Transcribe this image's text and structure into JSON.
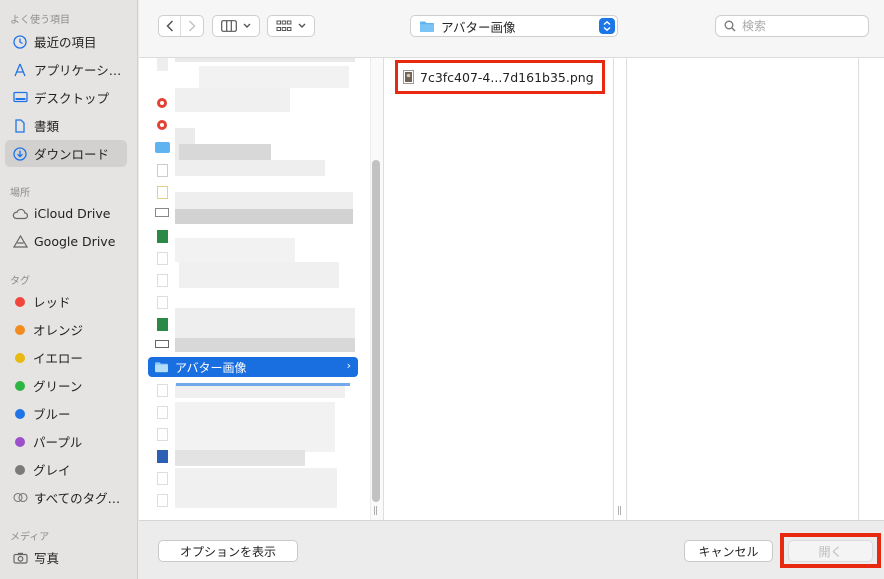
{
  "sidebar": {
    "favorites_heading": "よく使う項目",
    "favorites": [
      {
        "label": "最近の項目",
        "icon": "clock-icon"
      },
      {
        "label": "アプリケーシ…",
        "icon": "applications-icon"
      },
      {
        "label": "デスクトップ",
        "icon": "desktop-icon"
      },
      {
        "label": "書類",
        "icon": "document-icon"
      },
      {
        "label": "ダウンロード",
        "icon": "download-icon",
        "selected": true
      }
    ],
    "locations_heading": "場所",
    "locations": [
      {
        "label": "iCloud Drive",
        "icon": "cloud-icon"
      },
      {
        "label": "Google Drive",
        "icon": "drive-icon"
      }
    ],
    "tags_heading": "タグ",
    "tags": [
      {
        "label": "レッド",
        "color": "#f2453d"
      },
      {
        "label": "オレンジ",
        "color": "#f28c1e"
      },
      {
        "label": "イエロー",
        "color": "#e8b90f"
      },
      {
        "label": "グリーン",
        "color": "#2fb544"
      },
      {
        "label": "ブルー",
        "color": "#1f74e8"
      },
      {
        "label": "パープル",
        "color": "#9b4fc9"
      },
      {
        "label": "グレイ",
        "color": "#7a7a7a"
      },
      {
        "label": "すべてのタグ…",
        "color": ""
      }
    ],
    "media_heading": "メディア",
    "media": [
      {
        "label": "写真",
        "icon": "camera-icon"
      }
    ]
  },
  "toolbar": {
    "location": "アバター画像",
    "search_placeholder": "検索"
  },
  "browser": {
    "selected_folder": "アバター画像",
    "file_name": "7c3fc407-4...7d161b35.png"
  },
  "footer": {
    "options_label": "オプションを表示",
    "cancel_label": "キャンセル",
    "open_label": "開く"
  },
  "colors": {
    "accent": "#1a6fe0",
    "highlight_box": "#e8280f"
  }
}
